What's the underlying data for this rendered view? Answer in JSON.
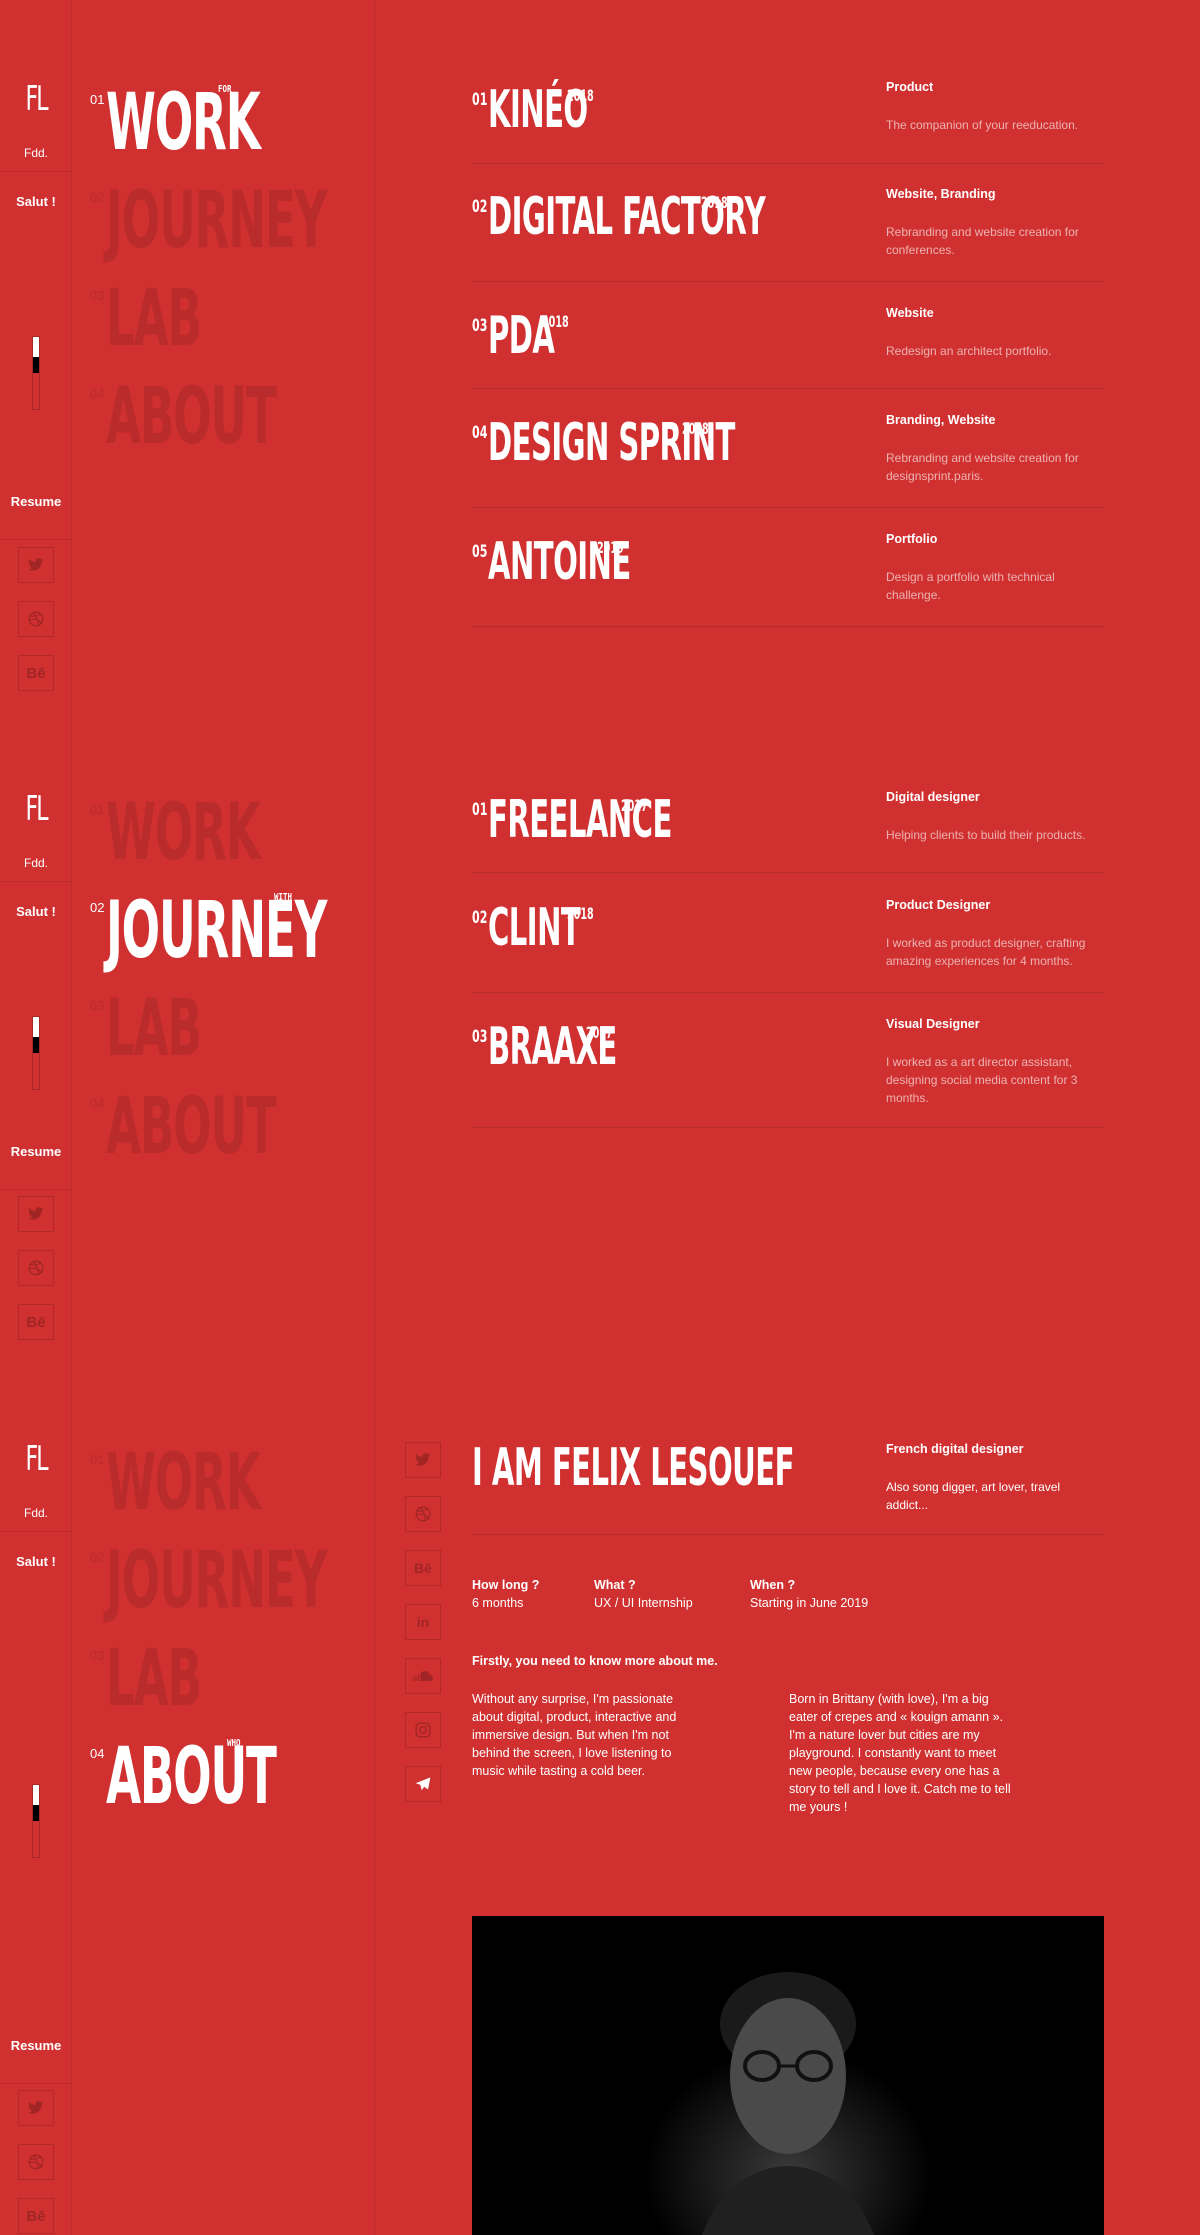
{
  "rail": {
    "logo": "FL",
    "logo_sub": "Fdd.",
    "greeting": "Salut !",
    "resume": "Resume",
    "social_icons": [
      "twitter-icon",
      "dribbble-icon",
      "behance-icon"
    ],
    "behance_label": "Bē"
  },
  "nav": {
    "items": [
      {
        "num": "01",
        "label": "WORK",
        "sup": "FOR"
      },
      {
        "num": "02",
        "label": "JOURNEY",
        "sup": "WITH"
      },
      {
        "num": "03",
        "label": "LAB",
        "sup": ""
      },
      {
        "num": "04",
        "label": "ABOUT",
        "sup": "WHO"
      }
    ]
  },
  "work": {
    "projects": [
      {
        "num": "01",
        "name": "KINÉO",
        "year": "2018",
        "category": "Product",
        "description": "The companion of your reeducation."
      },
      {
        "num": "02",
        "name": "DIGITAL FACTORY",
        "year": "2018",
        "category": "Website, Branding",
        "description": "Rebranding and website creation for conferences."
      },
      {
        "num": "03",
        "name": "PDA",
        "year": "2018",
        "category": "Website",
        "description": "Redesign an architect portfolio."
      },
      {
        "num": "04",
        "name": "DESIGN SPRINT",
        "year": "2018",
        "category": "Branding, Website",
        "description": "Rebranding and website creation for designsprint.paris."
      },
      {
        "num": "05",
        "name": "ANTOINE",
        "year": "2019",
        "category": "Portfolio",
        "description": "Design a portfolio with technical challenge."
      }
    ]
  },
  "journey": {
    "jobs": [
      {
        "num": "01",
        "name": "FREELANCE",
        "year": "2017",
        "category": "Digital designer",
        "description": "Helping clients to build their products."
      },
      {
        "num": "02",
        "name": "CLINT",
        "year": "2018",
        "category": "Product Designer",
        "description": "I worked as product designer, crafting amazing experiences for 4 months."
      },
      {
        "num": "03",
        "name": "BRAAXE",
        "year": "2017",
        "category": "Visual Designer",
        "description": "I worked as a art director assistant, designing social media content for 3 months."
      }
    ]
  },
  "about": {
    "title": "I AM FELIX LESOUEF",
    "category": "French digital designer",
    "description": "Also song digger, art lover, travel addict...",
    "social_icons": [
      "twitter-icon",
      "dribbble-icon",
      "behance-icon",
      "linkedin-icon",
      "soundcloud-icon",
      "instagram-icon",
      "telegram-icon"
    ],
    "facts": [
      {
        "label": "How long ?",
        "value": "6 months"
      },
      {
        "label": "What ?",
        "value": "UX / UI Internship"
      },
      {
        "label": "When ?",
        "value": "Starting in June 2019"
      }
    ],
    "intro": "Firstly, you need to know more about me.",
    "paragraph_1": "Without any surprise, I'm passionate about digital, product, interactive and immersive design. But when I'm not behind the screen, I love listening to music while tasting a cold beer.",
    "paragraph_2": "Born in Brittany (with love), I'm a big eater of crepes and « kouign amann ». I'm a nature lover but cities are my playground. I constantly want to meet new people, because every one has a story to tell and I love it. Catch me to tell  me yours !",
    "linkedin_label": "in"
  },
  "colors": {
    "background": "#d03030",
    "text": "#ffffff",
    "muted": "rgba(0,0,0,0.10)"
  }
}
